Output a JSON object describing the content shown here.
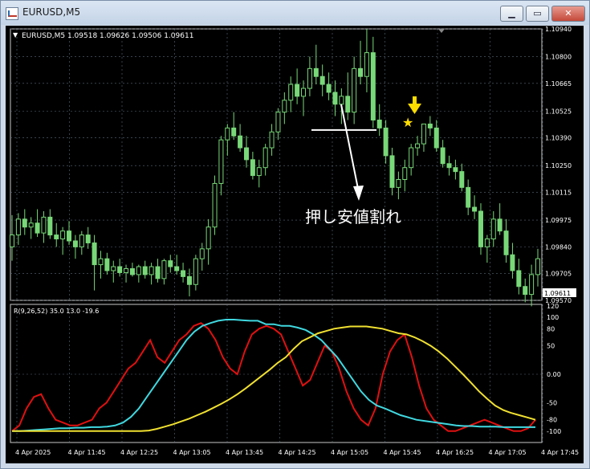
{
  "window": {
    "title": "EURUSD,M5",
    "minimize_label": "▁",
    "maximize_label": "▭",
    "close_label": "✕"
  },
  "chart_header": {
    "arrow_glyph": "▼",
    "text": "EURUSD,M5  1.09518 1.09626 1.09506 1.09611"
  },
  "annotation_text": "押し安値割れ",
  "current_price_label": "1.09611",
  "price_axis_labels": [
    "1.10940",
    "1.10800",
    "1.10665",
    "1.10525",
    "1.10390",
    "1.10250",
    "1.10115",
    "1.09975",
    "1.09840",
    "1.09705",
    "1.09570"
  ],
  "indicator": {
    "label": "R(9,26,52) 35.0 13.0 -19.6",
    "axis_labels": [
      "120",
      "100",
      "80",
      "50",
      "0.00",
      "-50",
      "-80",
      "-100"
    ]
  },
  "time_axis_labels": [
    "4 Apr 2025",
    "4 Apr 11:45",
    "4 Apr 12:25",
    "4 Apr 13:05",
    "4 Apr 13:45",
    "4 Apr 14:25",
    "4 Apr 15:05",
    "4 Apr 15:45",
    "4 Apr 16:25",
    "4 Apr 17:05",
    "4 Apr 17:45"
  ],
  "colors": {
    "background": "#000000",
    "candle": "#78d878",
    "grid": "#5a6a7a",
    "red_line": "#e01010",
    "cyan_line": "#40d8e0",
    "yellow_line": "#f0e030",
    "marker": "#ffdd00"
  },
  "chart_data": [
    {
      "type": "candlestick",
      "title": "EURUSD,M5",
      "ylim": [
        1.0957,
        1.1094
      ],
      "ohlc": [
        [
          1.0984,
          1.1,
          1.0977,
          1.099
        ],
        [
          1.099,
          1.1001,
          1.0985,
          1.0998
        ],
        [
          1.0998,
          1.1003,
          1.099,
          1.0994
        ],
        [
          1.0994,
          1.0999,
          1.0988,
          1.0996
        ],
        [
          1.0996,
          1.1003,
          1.0989,
          1.0991
        ],
        [
          1.0991,
          1.1002,
          1.0986,
          1.0999
        ],
        [
          1.0999,
          1.1003,
          1.0988,
          1.099
        ],
        [
          1.099,
          1.0996,
          1.0984,
          1.0988
        ],
        [
          1.0988,
          1.0994,
          1.098,
          1.0992
        ],
        [
          1.0992,
          1.0997,
          1.0985,
          1.0987
        ],
        [
          1.0987,
          1.099,
          1.0978,
          1.0984
        ],
        [
          1.0984,
          1.0992,
          1.098,
          1.099
        ],
        [
          1.099,
          1.0994,
          1.0983,
          1.0986
        ],
        [
          1.0986,
          1.099,
          1.0962,
          1.0975
        ],
        [
          1.0975,
          1.0982,
          1.0968,
          1.0978
        ],
        [
          1.0978,
          1.0981,
          1.097,
          1.0972
        ],
        [
          1.0972,
          1.0977,
          1.0966,
          1.0974
        ],
        [
          1.0974,
          1.0978,
          1.0969,
          1.0971
        ],
        [
          1.0971,
          1.0975,
          1.0966,
          1.0973
        ],
        [
          1.0973,
          1.0976,
          1.0969,
          1.097
        ],
        [
          1.097,
          1.0975,
          1.0966,
          1.0974
        ],
        [
          1.0974,
          1.0977,
          1.0968,
          1.097
        ],
        [
          1.097,
          1.0976,
          1.0965,
          1.0974
        ],
        [
          1.0974,
          1.0978,
          1.0966,
          1.0968
        ],
        [
          1.0968,
          1.0978,
          1.0965,
          1.0977
        ],
        [
          1.0977,
          1.098,
          1.0971,
          1.0974
        ],
        [
          1.0974,
          1.098,
          1.097,
          1.0972
        ],
        [
          1.0972,
          1.0976,
          1.0966,
          1.0969
        ],
        [
          1.0969,
          1.0973,
          1.0959,
          1.0965
        ],
        [
          1.0965,
          1.098,
          1.0962,
          1.0978
        ],
        [
          1.0978,
          1.0986,
          1.0972,
          1.0983
        ],
        [
          1.0983,
          1.0998,
          1.0975,
          1.0994
        ],
        [
          1.0994,
          1.102,
          1.099,
          1.1016
        ],
        [
          1.1016,
          1.104,
          1.101,
          1.1038
        ],
        [
          1.1038,
          1.1046,
          1.103,
          1.1044
        ],
        [
          1.1044,
          1.1052,
          1.1038,
          1.104
        ],
        [
          1.104,
          1.1046,
          1.1032,
          1.1034
        ],
        [
          1.1034,
          1.104,
          1.1024,
          1.1028
        ],
        [
          1.1028,
          1.1032,
          1.1018,
          1.102
        ],
        [
          1.102,
          1.1028,
          1.1014,
          1.1024
        ],
        [
          1.1024,
          1.1036,
          1.102,
          1.1034
        ],
        [
          1.1034,
          1.1046,
          1.103,
          1.1042
        ],
        [
          1.1042,
          1.1054,
          1.1038,
          1.1052
        ],
        [
          1.1052,
          1.1062,
          1.1046,
          1.1058
        ],
        [
          1.1058,
          1.107,
          1.1052,
          1.1066
        ],
        [
          1.1066,
          1.1074,
          1.1056,
          1.106
        ],
        [
          1.106,
          1.1068,
          1.105,
          1.1064
        ],
        [
          1.1064,
          1.108,
          1.106,
          1.1074
        ],
        [
          1.1074,
          1.1086,
          1.1066,
          1.107
        ],
        [
          1.107,
          1.1076,
          1.106,
          1.1066
        ],
        [
          1.1066,
          1.1072,
          1.1058,
          1.1062
        ],
        [
          1.1062,
          1.1068,
          1.105,
          1.1056
        ],
        [
          1.1056,
          1.1064,
          1.1046,
          1.106
        ],
        [
          1.106,
          1.1072,
          1.1048,
          1.1052
        ],
        [
          1.1052,
          1.108,
          1.1046,
          1.1074
        ],
        [
          1.1074,
          1.1088,
          1.1066,
          1.107
        ],
        [
          1.107,
          1.1094,
          1.1062,
          1.1082
        ],
        [
          1.1082,
          1.109,
          1.1044,
          1.1048
        ],
        [
          1.1048,
          1.1056,
          1.104,
          1.1044
        ],
        [
          1.1044,
          1.1048,
          1.1026,
          1.103
        ],
        [
          1.103,
          1.1034,
          1.101,
          1.1014
        ],
        [
          1.1014,
          1.1022,
          1.1008,
          1.1018
        ],
        [
          1.1018,
          1.1028,
          1.1012,
          1.1024
        ],
        [
          1.1024,
          1.1036,
          1.102,
          1.1034
        ],
        [
          1.1034,
          1.104,
          1.103,
          1.1036
        ],
        [
          1.1036,
          1.1046,
          1.1032,
          1.1046
        ],
        [
          1.1046,
          1.105,
          1.104,
          1.1044
        ],
        [
          1.1044,
          1.1048,
          1.1032,
          1.1034
        ],
        [
          1.1034,
          1.1038,
          1.1024,
          1.1026
        ],
        [
          1.1026,
          1.103,
          1.102,
          1.1024
        ],
        [
          1.1024,
          1.1028,
          1.1018,
          1.1022
        ],
        [
          1.1022,
          1.1026,
          1.1012,
          1.1014
        ],
        [
          1.1014,
          1.1018,
          1.1,
          1.1004
        ],
        [
          1.1004,
          1.101,
          1.0998,
          1.1002
        ],
        [
          1.1002,
          1.1006,
          1.098,
          1.0984
        ],
        [
          1.0984,
          1.099,
          1.0976,
          1.0988
        ],
        [
          1.0988,
          1.1002,
          1.0984,
          1.0998
        ],
        [
          1.0998,
          1.1006,
          1.099,
          1.0992
        ],
        [
          1.0992,
          1.0998,
          1.0976,
          1.098
        ],
        [
          1.098,
          1.0986,
          1.0968,
          1.0972
        ],
        [
          1.0972,
          1.0978,
          1.096,
          1.0964
        ],
        [
          1.0964,
          1.0968,
          1.0956,
          1.096
        ],
        [
          1.096,
          1.0975,
          1.0954,
          1.097
        ],
        [
          1.097,
          1.0983,
          1.0964,
          1.0978
        ]
      ],
      "annotation_level": 1.1043
    },
    {
      "type": "line",
      "ylim": [
        -120,
        120
      ],
      "series": [
        {
          "color": "red",
          "values": [
            -100,
            -90,
            -60,
            -40,
            -35,
            -60,
            -80,
            -85,
            -90,
            -90,
            -85,
            -80,
            -60,
            -50,
            -30,
            -10,
            10,
            20,
            40,
            60,
            30,
            20,
            40,
            60,
            70,
            85,
            90,
            80,
            60,
            30,
            10,
            0,
            40,
            70,
            80,
            85,
            80,
            70,
            40,
            10,
            -20,
            -10,
            20,
            50,
            40,
            10,
            -30,
            -60,
            -80,
            -90,
            -60,
            0,
            40,
            60,
            70,
            30,
            -20,
            -60,
            -80,
            -90,
            -100,
            -100,
            -95,
            -90,
            -85,
            -80,
            -85,
            -90,
            -95,
            -100,
            -100,
            -95,
            -80
          ]
        },
        {
          "color": "cyan",
          "values": [
            -100,
            -100,
            -99,
            -98,
            -97,
            -96,
            -95,
            -95,
            -94,
            -94,
            -93,
            -93,
            -92,
            -90,
            -85,
            -75,
            -60,
            -40,
            -20,
            0,
            20,
            40,
            60,
            75,
            85,
            90,
            94,
            96,
            96,
            95,
            94,
            94,
            88,
            88,
            85,
            85,
            82,
            78,
            70,
            60,
            45,
            30,
            10,
            -10,
            -30,
            -45,
            -55,
            -60,
            -66,
            -72,
            -76,
            -80,
            -82,
            -84,
            -86,
            -88,
            -90,
            -91,
            -91,
            -92,
            -92,
            -92,
            -93,
            -93,
            -93,
            -93,
            -93
          ]
        },
        {
          "color": "yellow",
          "values": [
            -100,
            -100,
            -100,
            -100,
            -100,
            -100,
            -100,
            -100,
            -100,
            -100,
            -100,
            -100,
            -100,
            -100,
            -100,
            -100,
            -100,
            -99,
            -96,
            -92,
            -88,
            -83,
            -78,
            -72,
            -66,
            -59,
            -52,
            -44,
            -35,
            -25,
            -14,
            -3,
            8,
            20,
            30,
            45,
            58,
            65,
            72,
            76,
            80,
            82,
            84,
            84,
            84,
            82,
            80,
            76,
            72,
            70,
            65,
            58,
            50,
            40,
            28,
            14,
            0,
            -15,
            -30,
            -43,
            -55,
            -63,
            -68,
            -72,
            -76,
            -80
          ]
        }
      ]
    }
  ]
}
